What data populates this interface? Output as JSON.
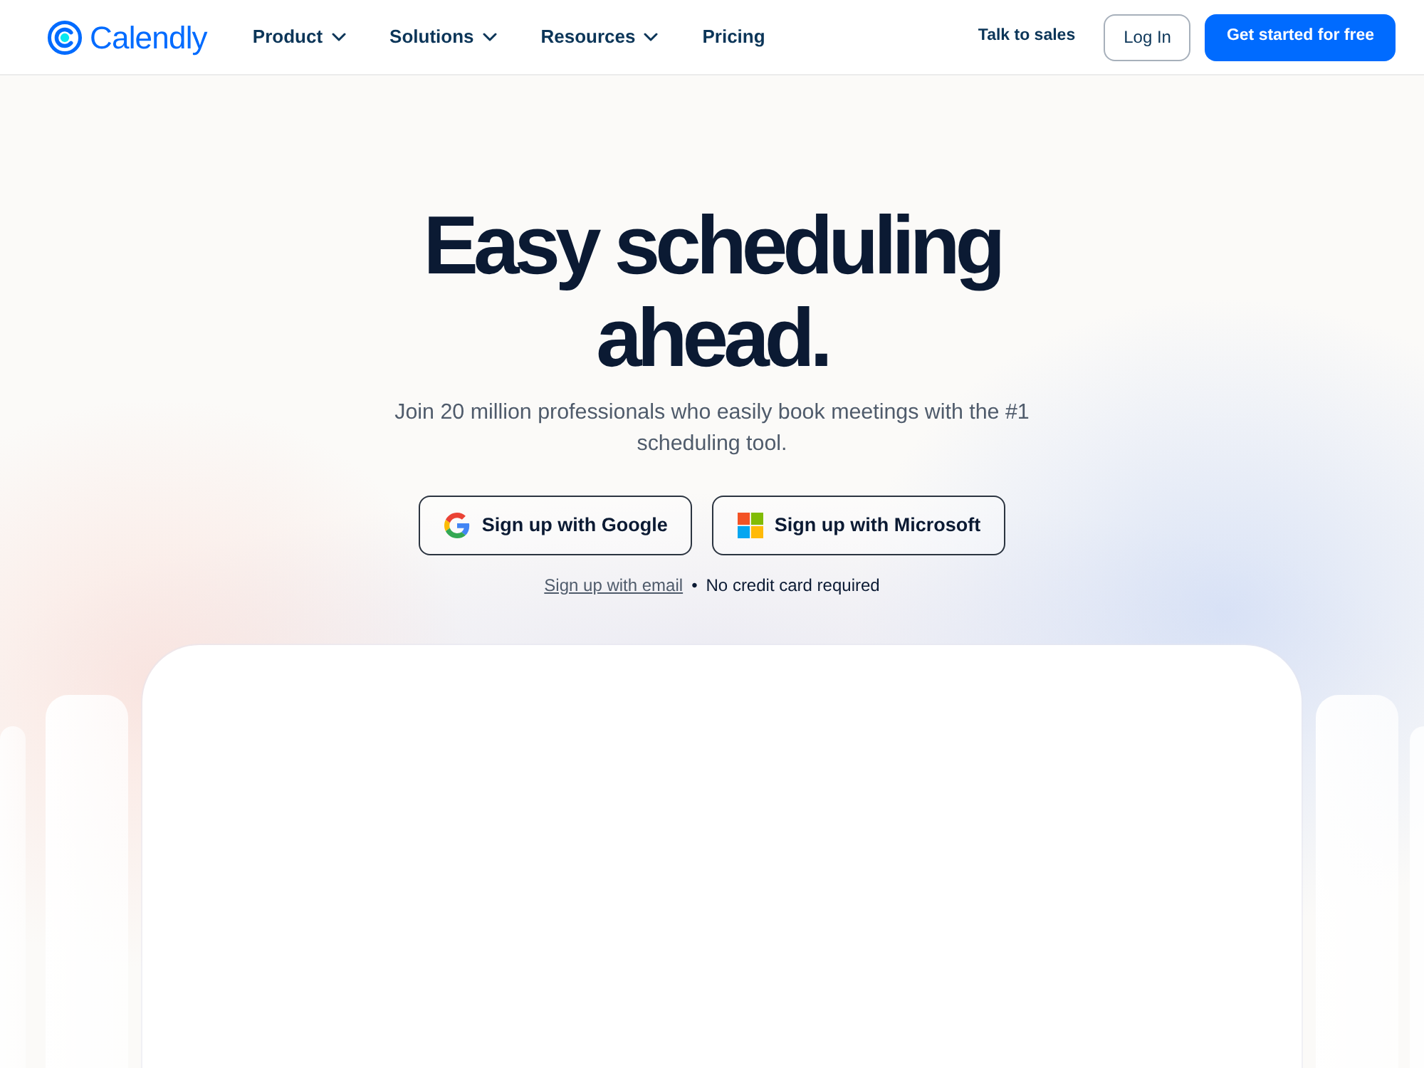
{
  "nav": {
    "logo": "Calendly",
    "items": [
      {
        "label": "Product",
        "dropdown": true
      },
      {
        "label": "Solutions",
        "dropdown": true
      },
      {
        "label": "Resources",
        "dropdown": true
      },
      {
        "label": "Pricing",
        "dropdown": false
      }
    ],
    "actions": [
      {
        "label": "Talk to sales",
        "kind": "link"
      },
      {
        "label": "Log In",
        "kind": "outline"
      },
      {
        "label": "Get started for free",
        "kind": "primary"
      }
    ]
  },
  "hero": {
    "title": "Easy scheduling ahead.",
    "subtitle": "Join 20 million professionals who easily book meetings with the #1 scheduling tool.",
    "buttons": [
      {
        "label": "Sign up with Google",
        "kind": "google"
      },
      {
        "label": "Sign up with Microsoft",
        "kind": "microsoft"
      }
    ],
    "note": {
      "link": "Sign up with email",
      "separator": "•",
      "text": "No credit card required"
    }
  }
}
